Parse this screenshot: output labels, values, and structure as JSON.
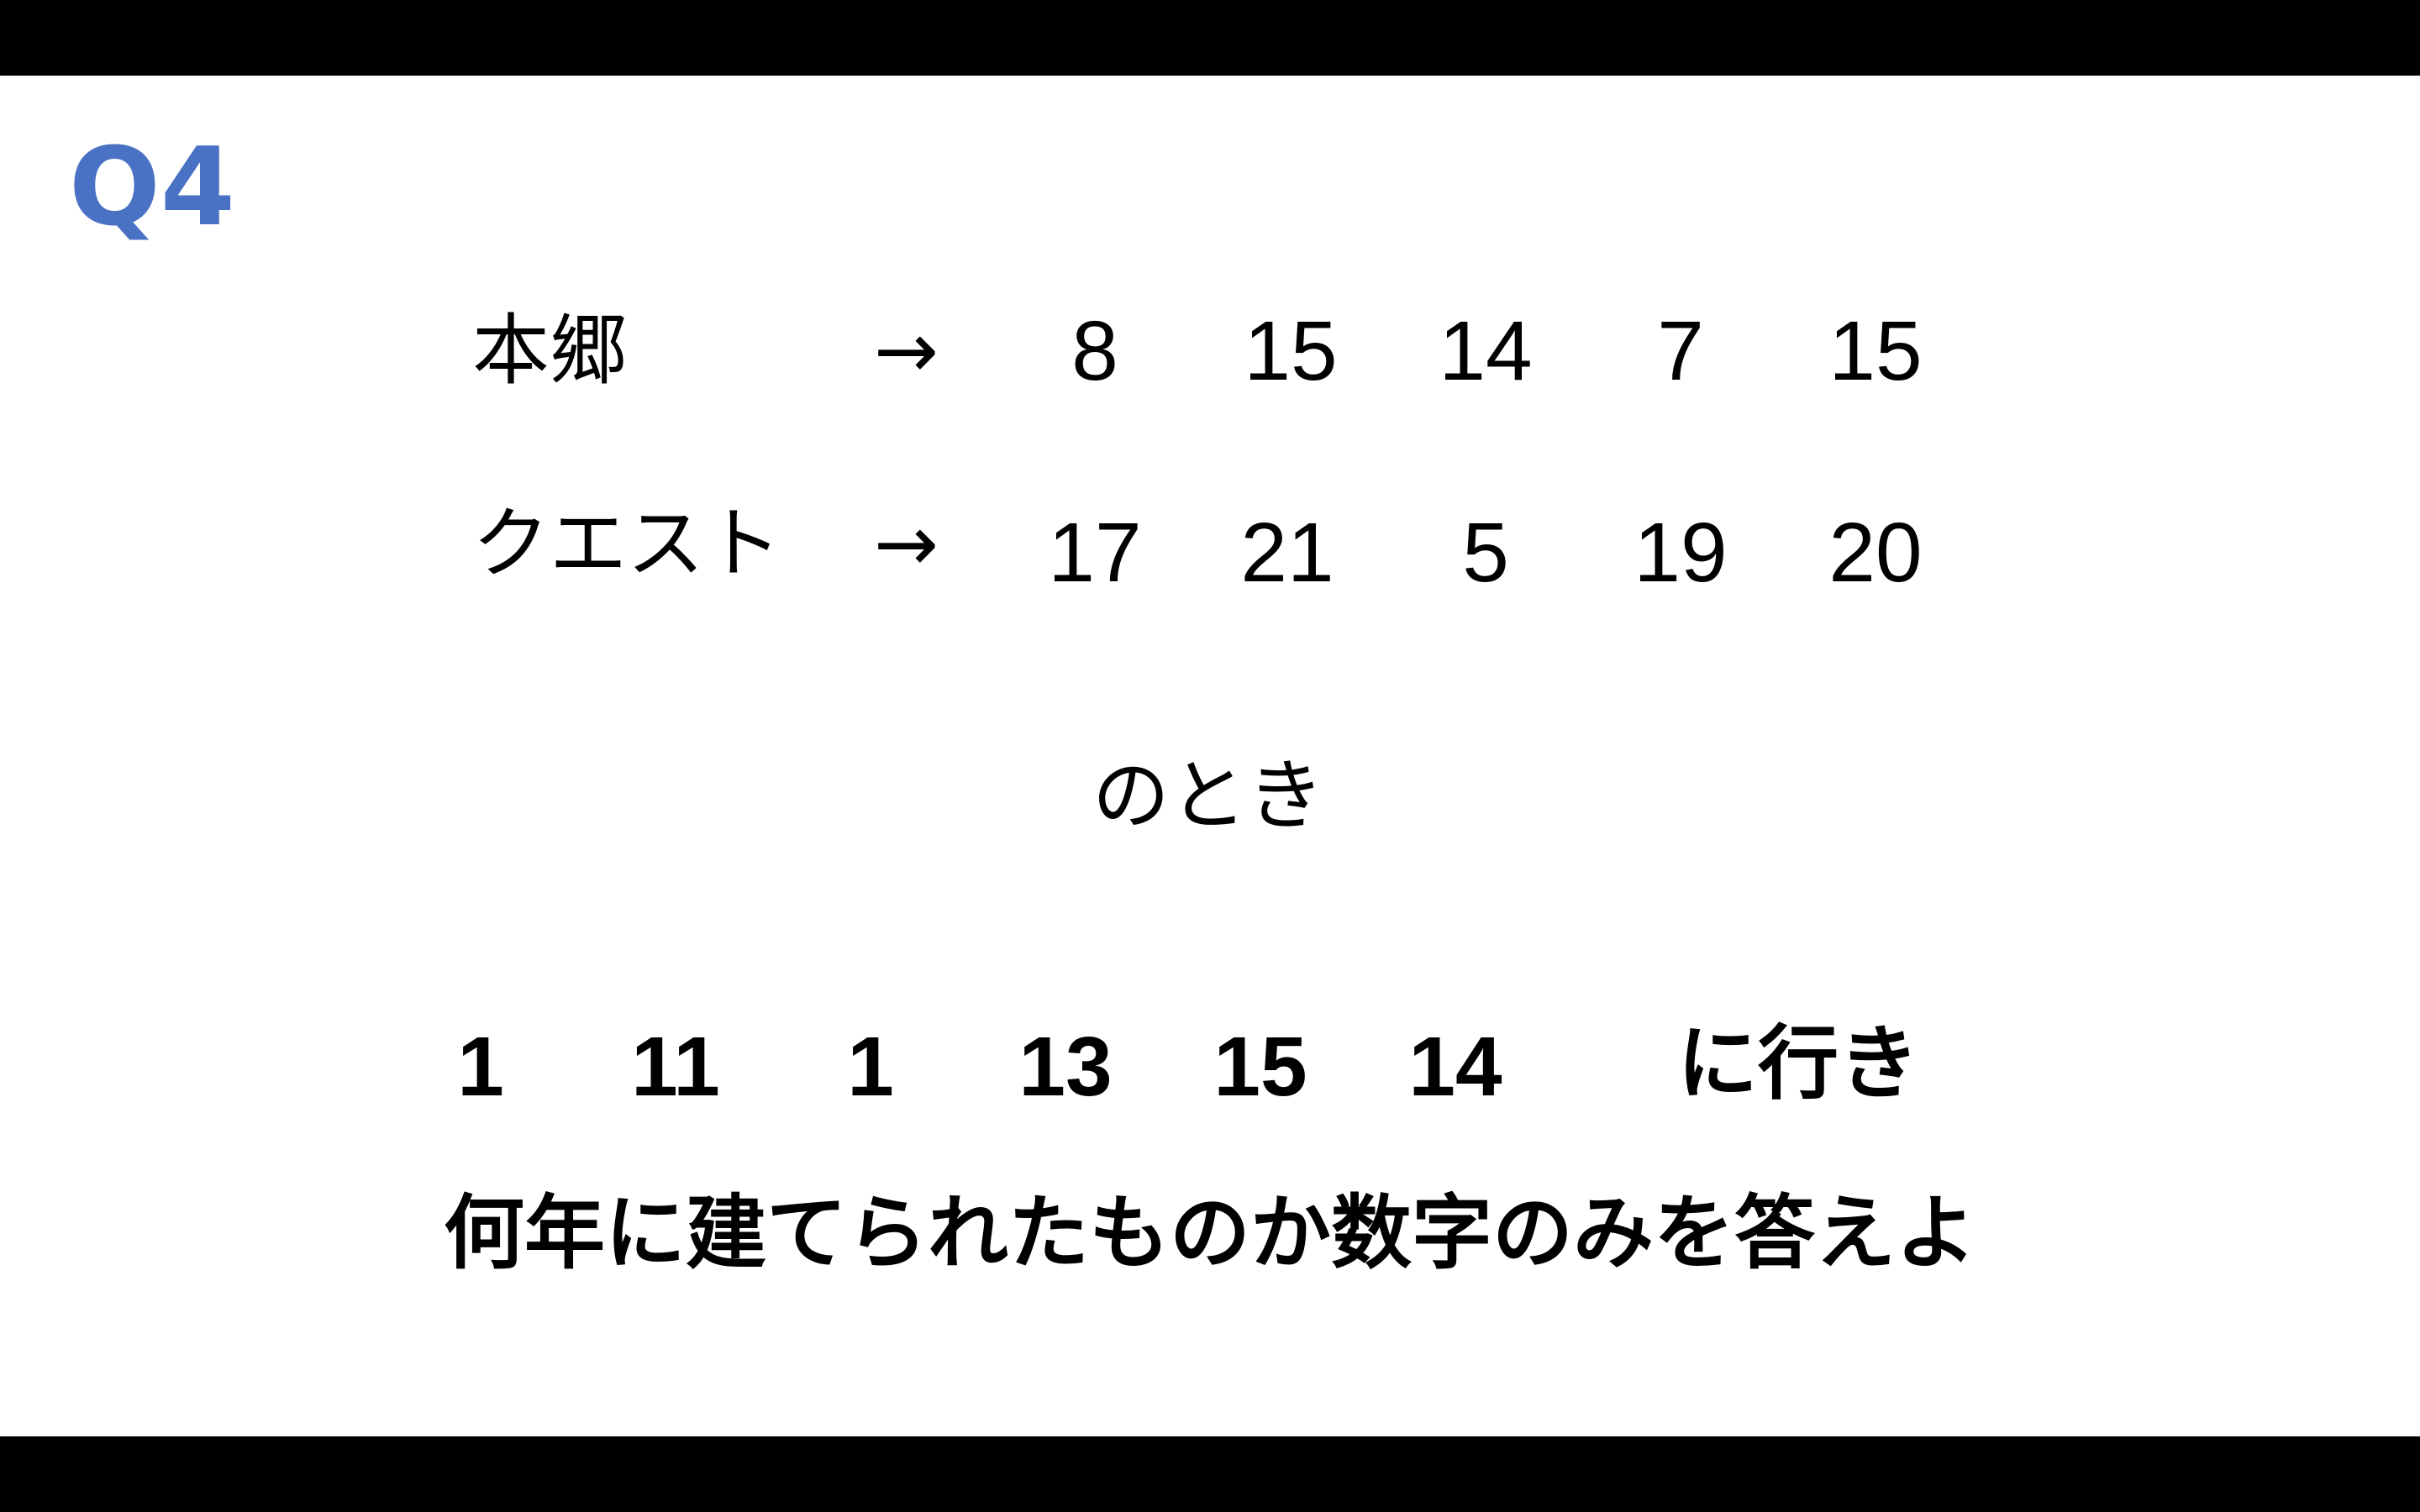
{
  "slide": {
    "question_number": "Q4",
    "rows": [
      {
        "label": "本郷",
        "arrow": "→",
        "numbers": [
          "8",
          "15",
          "14",
          "7",
          "15"
        ]
      },
      {
        "label": "クエスト",
        "arrow": "→",
        "numbers": [
          "17",
          "21",
          "5",
          "19",
          "20"
        ]
      }
    ],
    "connector": "のとき",
    "target_numbers": [
      "1",
      "11",
      "1",
      "13",
      "15",
      "14"
    ],
    "target_suffix": "に行き",
    "question": "何年に建てられたものか数字のみを答えよ"
  },
  "colors": {
    "accent": "#4a72c4",
    "text": "#000000",
    "background": "#ffffff",
    "letterbox": "#000000"
  }
}
